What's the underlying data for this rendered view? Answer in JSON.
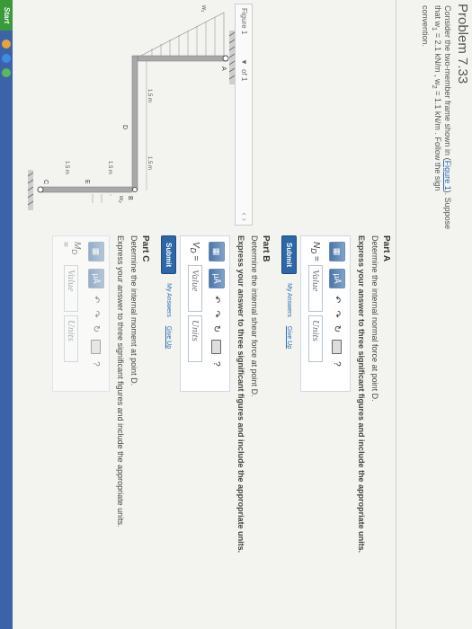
{
  "problem": {
    "title": "Problem 7.33",
    "text_1": "Consider the two-member frame shown in (",
    "figure_link": "Figure 1",
    "text_2": "). Suppose that w",
    "w1_sub": "1",
    "text_3": " = 2.1 kN/m , w",
    "w2_sub": "2",
    "text_4": " = 1.1 kN/m . Follow the sign convention."
  },
  "figure": {
    "label": "Figure 1",
    "pager": "of 1",
    "dims": {
      "left": "1.5 m",
      "right": "1.5 m",
      "vert_top": "1.5 m",
      "vert_bottom": "1.5 m"
    },
    "points": {
      "A": "A",
      "B": "B",
      "C": "C",
      "D": "D",
      "E": "E"
    },
    "loads": {
      "w1": "w₁",
      "w2": "w₂"
    }
  },
  "partA": {
    "title": "Part A",
    "question": "Determine the internal normal force at point D.",
    "instruction": "Express your answer to three significant figures and include the appropriate units.",
    "var": "N",
    "var_sub": "D",
    "eq": "=",
    "value_placeholder": "Value",
    "units_placeholder": "Units",
    "submit": "Submit",
    "my_answers": "My Answers",
    "give_up": "Give Up"
  },
  "partB": {
    "title": "Part B",
    "question": "Determine the internal shear force at point D.",
    "instruction": "Express your answer to three significant figures and include the appropriate units.",
    "var": "V",
    "var_sub": "D",
    "eq": "=",
    "value_placeholder": "Value",
    "units_placeholder": "Units",
    "submit": "Submit",
    "my_answers": "My Answers",
    "give_up": "Give Up"
  },
  "partC": {
    "title": "Part C",
    "question": "Determine the internal moment at point D.",
    "instruction": "Express your answer to three significant figures and include the appropriate units.",
    "var": "M",
    "var_sub": "D",
    "eq": "=",
    "value_placeholder": "Value",
    "units_placeholder": "Units"
  },
  "toolbar": {
    "mu": "μÅ",
    "help": "?"
  },
  "taskbar": {
    "start": "Start"
  }
}
